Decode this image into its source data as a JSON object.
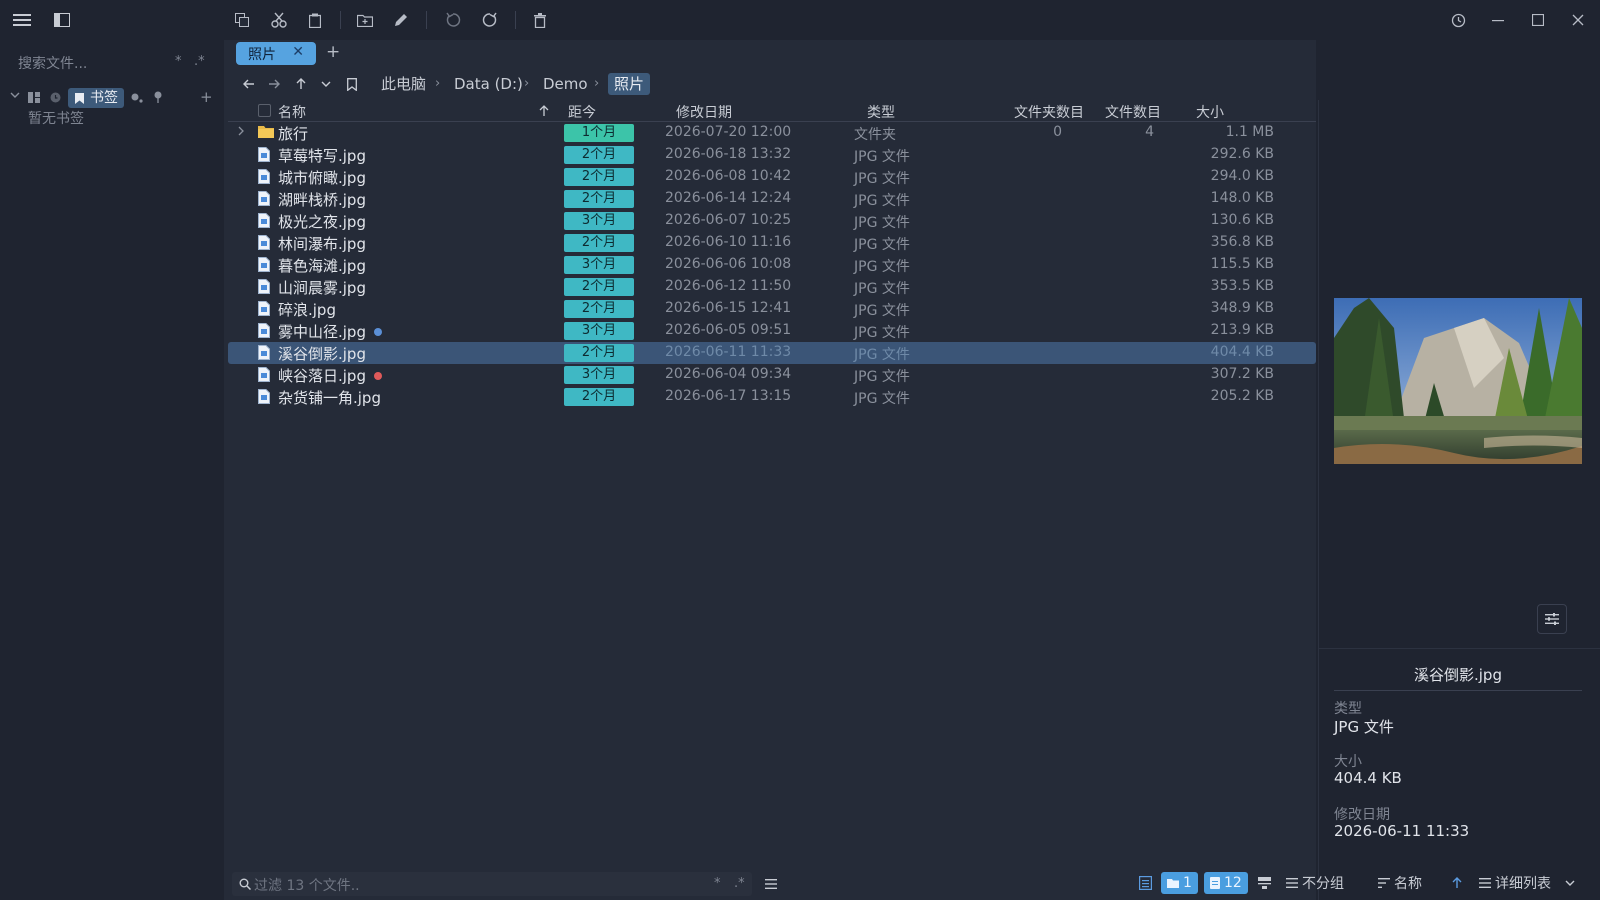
{
  "sidebar": {
    "search_placeholder": "搜索文件...",
    "search_opt_star": "*",
    "search_opt_regex": ".*",
    "bookmarks_label": "书签",
    "empty_text": "暂无书签"
  },
  "tabs": [
    {
      "label": "照片"
    }
  ],
  "breadcrumb": [
    "此电脑",
    "Data (D:)",
    "Demo",
    "照片"
  ],
  "columns": {
    "name": "名称",
    "age": "距今",
    "modified": "修改日期",
    "type": "类型",
    "folder_count": "文件夹数目",
    "item_count": "文件数目",
    "size": "大小"
  },
  "rows": [
    {
      "name": "旅行",
      "age": "1个月",
      "modified": "2026-07-20 12:00",
      "type": "文件夹",
      "folder_count": "0",
      "item_count": "4",
      "size": "1.1 MB",
      "kind": "folder"
    },
    {
      "name": "草莓特写.jpg",
      "age": "2个月",
      "modified": "2026-06-18 13:32",
      "type": "JPG 文件",
      "size": "292.6 KB",
      "kind": "file"
    },
    {
      "name": "城市俯瞰.jpg",
      "age": "2个月",
      "modified": "2026-06-08 10:42",
      "type": "JPG 文件",
      "size": "294.0 KB",
      "kind": "file"
    },
    {
      "name": "湖畔栈桥.jpg",
      "age": "2个月",
      "modified": "2026-06-14 12:24",
      "type": "JPG 文件",
      "size": "148.0 KB",
      "kind": "file"
    },
    {
      "name": "极光之夜.jpg",
      "age": "3个月",
      "modified": "2026-06-07 10:25",
      "type": "JPG 文件",
      "size": "130.6 KB",
      "kind": "file"
    },
    {
      "name": "林间瀑布.jpg",
      "age": "2个月",
      "modified": "2026-06-10 11:16",
      "type": "JPG 文件",
      "size": "356.8 KB",
      "kind": "file"
    },
    {
      "name": "暮色海滩.jpg",
      "age": "3个月",
      "modified": "2026-06-06 10:08",
      "type": "JPG 文件",
      "size": "115.5 KB",
      "kind": "file"
    },
    {
      "name": "山涧晨雾.jpg",
      "age": "2个月",
      "modified": "2026-06-12 11:50",
      "type": "JPG 文件",
      "size": "353.5 KB",
      "kind": "file"
    },
    {
      "name": "碎浪.jpg",
      "age": "2个月",
      "modified": "2026-06-15 12:41",
      "type": "JPG 文件",
      "size": "348.9 KB",
      "kind": "file"
    },
    {
      "name": "雾中山径.jpg",
      "age": "3个月",
      "modified": "2026-06-05 09:51",
      "type": "JPG 文件",
      "size": "213.9 KB",
      "kind": "file",
      "tag": "#5b8fd6"
    },
    {
      "name": "溪谷倒影.jpg",
      "age": "2个月",
      "modified": "2026-06-11 11:33",
      "type": "JPG 文件",
      "size": "404.4 KB",
      "kind": "file",
      "selected": true
    },
    {
      "name": "峡谷落日.jpg",
      "age": "3个月",
      "modified": "2026-06-04 09:34",
      "type": "JPG 文件",
      "size": "307.2 KB",
      "kind": "file",
      "tag": "#e05a5a"
    },
    {
      "name": "杂货铺一角.jpg",
      "age": "2个月",
      "modified": "2026-06-17 13:15",
      "type": "JPG 文件",
      "size": "205.2 KB",
      "kind": "file"
    }
  ],
  "preview": {
    "filename": "溪谷倒影.jpg",
    "type_label": "类型",
    "type_value": "JPG 文件",
    "size_label": "大小",
    "size_value": "404.4 KB",
    "modified_label": "修改日期",
    "modified_value": "2026-06-11 11:33"
  },
  "statusbar": {
    "filter_placeholder": "过滤 13 个文件..",
    "filter_opt_star": "*",
    "filter_opt_regex": ".*",
    "folder_count": "1",
    "file_count": "12",
    "group_label": "不分组",
    "sort_label": "名称",
    "view_label": "详细列表"
  },
  "colors": {
    "accent": "#56a3e0",
    "selection": "#3b5577",
    "age_badge": "#3fb8c4",
    "age_badge_recent": "#3cc4a9",
    "background": "#1f2430",
    "pane": "#252b38"
  }
}
